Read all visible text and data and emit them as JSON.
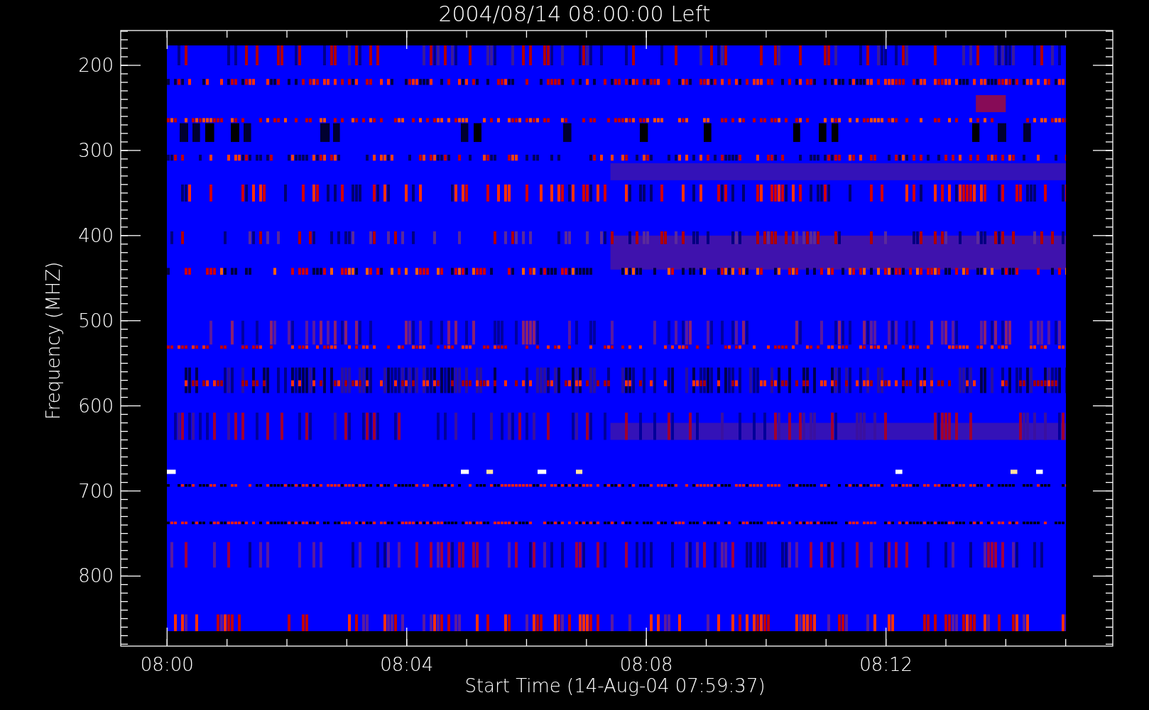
{
  "title": "2004/08/14 08:00:00 Left",
  "y_axis": {
    "label": "Frequency (MHZ)",
    "ticks": [
      "200",
      "300",
      "400",
      "500",
      "600",
      "700",
      "800"
    ]
  },
  "x_axis": {
    "label": "Start Time (14-Aug-04 07:59:37)",
    "ticks": [
      "08:00",
      "08:04",
      "08:08",
      "08:12"
    ]
  }
}
